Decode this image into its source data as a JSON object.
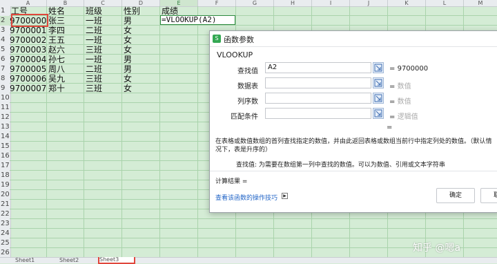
{
  "sheet": {
    "columns": [
      "A",
      "B",
      "C",
      "D",
      "E",
      "F",
      "G",
      "H",
      "I",
      "J",
      "K",
      "L",
      "M"
    ],
    "row_numbers": [
      "1",
      "2",
      "3",
      "4",
      "5",
      "6",
      "7",
      "8",
      "9",
      "10",
      "11",
      "12",
      "13",
      "14",
      "15",
      "16",
      "17",
      "18",
      "19",
      "20",
      "21",
      "22",
      "23",
      "24",
      "25",
      "26"
    ],
    "header_row": {
      "a": "工号",
      "b": "姓名",
      "c": "班级",
      "d": "性别",
      "e": "成绩"
    },
    "rows": [
      {
        "a": "9700000",
        "b": "张三",
        "c": "一班",
        "d": "男"
      },
      {
        "a": "9700001",
        "b": "李四",
        "c": "二班",
        "d": "女"
      },
      {
        "a": "9700002",
        "b": "王五",
        "c": "一班",
        "d": "女"
      },
      {
        "a": "9700003",
        "b": "赵六",
        "c": "三班",
        "d": "女"
      },
      {
        "a": "9700004",
        "b": "孙七",
        "c": "一班",
        "d": "男"
      },
      {
        "a": "9700005",
        "b": "周八",
        "c": "二班",
        "d": "男"
      },
      {
        "a": "9700006",
        "b": "吴九",
        "c": "三班",
        "d": "女"
      },
      {
        "a": "9700007",
        "b": "郑十",
        "c": "三班",
        "d": "女"
      }
    ],
    "formula": "=VLOOKUP(A2)"
  },
  "dialog": {
    "title": "函数参数",
    "function_name": "VLOOKUP",
    "params": [
      {
        "label": "查找值",
        "value": "A2",
        "result_eq": "=",
        "result": "9700000",
        "hint": ""
      },
      {
        "label": "数据表",
        "value": "",
        "result_eq": "=",
        "result": "",
        "hint": "数值"
      },
      {
        "label": "列序数",
        "value": "",
        "result_eq": "=",
        "result": "",
        "hint": "数值"
      },
      {
        "label": "匹配条件",
        "value": "",
        "result_eq": "=",
        "result": "",
        "hint": "逻辑值"
      }
    ],
    "equals": "=",
    "description": "在表格或数值数组的首列查找指定的数值，并由此返回表格或数组当前行中指定列处的数值。（默认情况下，表是升序的）",
    "param_desc_label": "查找值:",
    "param_desc": "为需要在数组第一列中查找的数值。可以为数值、引用或文本字符串",
    "calc_result": "计算结果 =",
    "help_link": "查看该函数的操作技巧",
    "ok_label": "确定",
    "cancel_label": "取消"
  },
  "sheet_tabs": [
    "Sheet1",
    "Sheet2",
    "Sheet3"
  ],
  "watermark": "知乎 @嗯a",
  "colors": {
    "grid_bg": "#d4ecd5",
    "highlight": "#e0463c",
    "link": "#1f63c6"
  }
}
